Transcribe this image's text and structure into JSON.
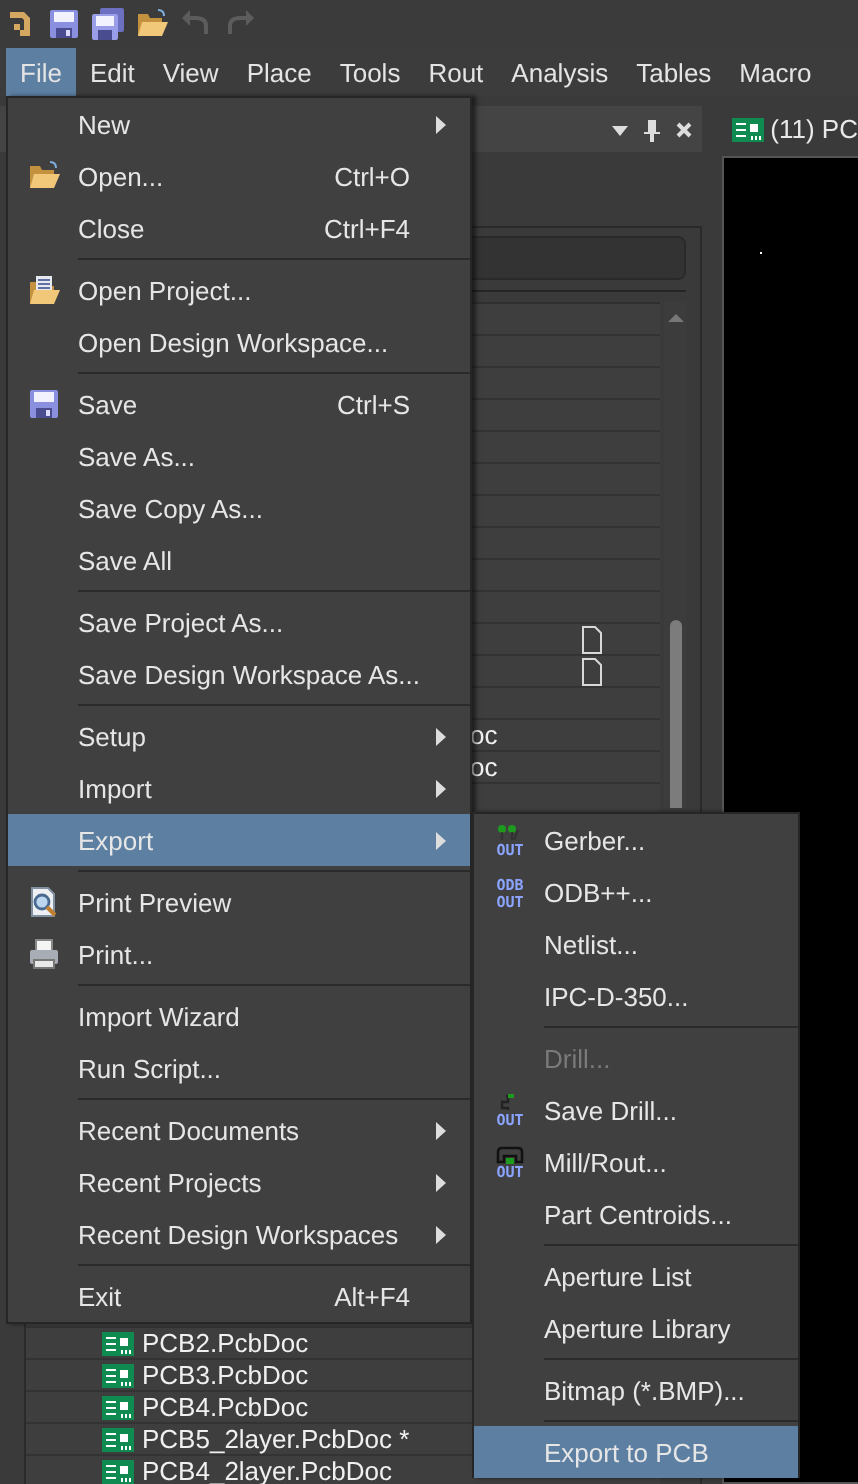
{
  "toolbar": {
    "buttons": [
      {
        "disabled": false
      },
      {
        "disabled": false
      },
      {
        "disabled": false
      },
      {
        "disabled": false
      },
      {
        "disabled": true
      },
      {
        "disabled": true
      }
    ]
  },
  "menubar": [
    {
      "label": "File",
      "selected": true
    },
    {
      "label": "Edit",
      "selected": false
    },
    {
      "label": "View",
      "selected": false
    },
    {
      "label": "Place",
      "selected": false
    },
    {
      "label": "Tools",
      "selected": false
    },
    {
      "label": "Rout",
      "selected": false
    },
    {
      "label": "Analysis",
      "selected": false
    },
    {
      "label": "Tables",
      "selected": false
    },
    {
      "label": "Macro",
      "selected": false
    }
  ],
  "panel": {
    "rows": [
      {
        "kind": "document"
      },
      {
        "kind": "document"
      },
      {
        "kind": "text",
        "label": "oc"
      },
      {
        "kind": "text",
        "label": "oc"
      },
      {
        "kind": "pcb",
        "label": "PCB2.PcbDoc"
      },
      {
        "kind": "pcb",
        "label": "PCB3.PcbDoc"
      },
      {
        "kind": "pcb",
        "label": "PCB4.PcbDoc"
      },
      {
        "kind": "pcb",
        "label": "PCB5_2layer.PcbDoc *"
      },
      {
        "kind": "pcb",
        "label": "PCB4_2layer.PcbDoc"
      }
    ]
  },
  "document": {
    "tab": {
      "label": "(11) PC"
    }
  },
  "file_menu": {
    "groups": [
      [
        {
          "label": "New",
          "submenu": true,
          "selected": false
        },
        {
          "label": "Open...",
          "shortcut": "Ctrl+O",
          "icon": {
            "kind": "open"
          },
          "submenu": false,
          "selected": false
        },
        {
          "label": "Close",
          "shortcut": "Ctrl+F4",
          "submenu": false,
          "selected": false
        }
      ],
      [
        {
          "label": "Open Project...",
          "icon": {
            "kind": "open-project"
          },
          "submenu": false,
          "selected": false
        },
        {
          "label": "Open Design Workspace...",
          "submenu": false,
          "selected": false
        }
      ],
      [
        {
          "label": "Save",
          "shortcut": "Ctrl+S",
          "icon": {
            "kind": "save"
          },
          "submenu": false,
          "selected": false
        },
        {
          "label": "Save As...",
          "submenu": false,
          "selected": false
        },
        {
          "label": "Save Copy As...",
          "submenu": false,
          "selected": false
        },
        {
          "label": "Save All",
          "submenu": false,
          "selected": false
        }
      ],
      [
        {
          "label": "Save Project As...",
          "submenu": false,
          "selected": false
        },
        {
          "label": "Save Design Workspace As...",
          "submenu": false,
          "selected": false
        }
      ],
      [
        {
          "label": "Setup",
          "submenu": true,
          "selected": false
        },
        {
          "label": "Import",
          "submenu": true,
          "selected": false
        },
        {
          "label": "Export",
          "submenu": true,
          "selected": true
        }
      ],
      [
        {
          "label": "Print Preview",
          "icon": {
            "kind": "print-preview"
          },
          "submenu": false,
          "selected": false
        },
        {
          "label": "Print...",
          "icon": {
            "kind": "print"
          },
          "submenu": false,
          "selected": false
        }
      ],
      [
        {
          "label": "Import Wizard",
          "submenu": false,
          "selected": false
        },
        {
          "label": "Run Script...",
          "submenu": false,
          "selected": false
        }
      ],
      [
        {
          "label": "Recent Documents",
          "submenu": true,
          "selected": false
        },
        {
          "label": "Recent Projects",
          "submenu": true,
          "selected": false
        },
        {
          "label": "Recent Design Workspaces",
          "submenu": true,
          "selected": false
        }
      ],
      [
        {
          "label": "Exit",
          "shortcut": "Alt+F4",
          "submenu": false,
          "selected": false
        }
      ]
    ]
  },
  "export_menu": {
    "groups": [
      [
        {
          "label": "Gerber...",
          "icon": {
            "kind": "gerber",
            "text": [
              "OUT"
            ]
          },
          "disabled": false,
          "selected": false
        },
        {
          "label": "ODB++...",
          "icon": {
            "kind": "odb",
            "text": [
              "ODB",
              "OUT"
            ]
          },
          "disabled": false,
          "selected": false
        },
        {
          "label": "Netlist...",
          "disabled": false,
          "selected": false
        },
        {
          "label": "IPC-D-350...",
          "disabled": false,
          "selected": false
        }
      ],
      [
        {
          "label": "Drill...",
          "disabled": true,
          "selected": false
        },
        {
          "label": "Save Drill...",
          "icon": {
            "kind": "drill",
            "text": [
              "OUT"
            ]
          },
          "disabled": false,
          "selected": false
        },
        {
          "label": "Mill/Rout...",
          "icon": {
            "kind": "mill",
            "text": [
              "OUT"
            ]
          },
          "disabled": false,
          "selected": false
        },
        {
          "label": "Part Centroids...",
          "disabled": false,
          "selected": false
        }
      ],
      [
        {
          "label": "Aperture List",
          "disabled": false,
          "selected": false
        },
        {
          "label": "Aperture Library",
          "disabled": false,
          "selected": false
        }
      ],
      [
        {
          "label": "Bitmap (*.BMP)...",
          "disabled": false,
          "selected": false
        }
      ],
      [
        {
          "label": "Export to PCB",
          "disabled": false,
          "selected": true
        }
      ]
    ]
  }
}
